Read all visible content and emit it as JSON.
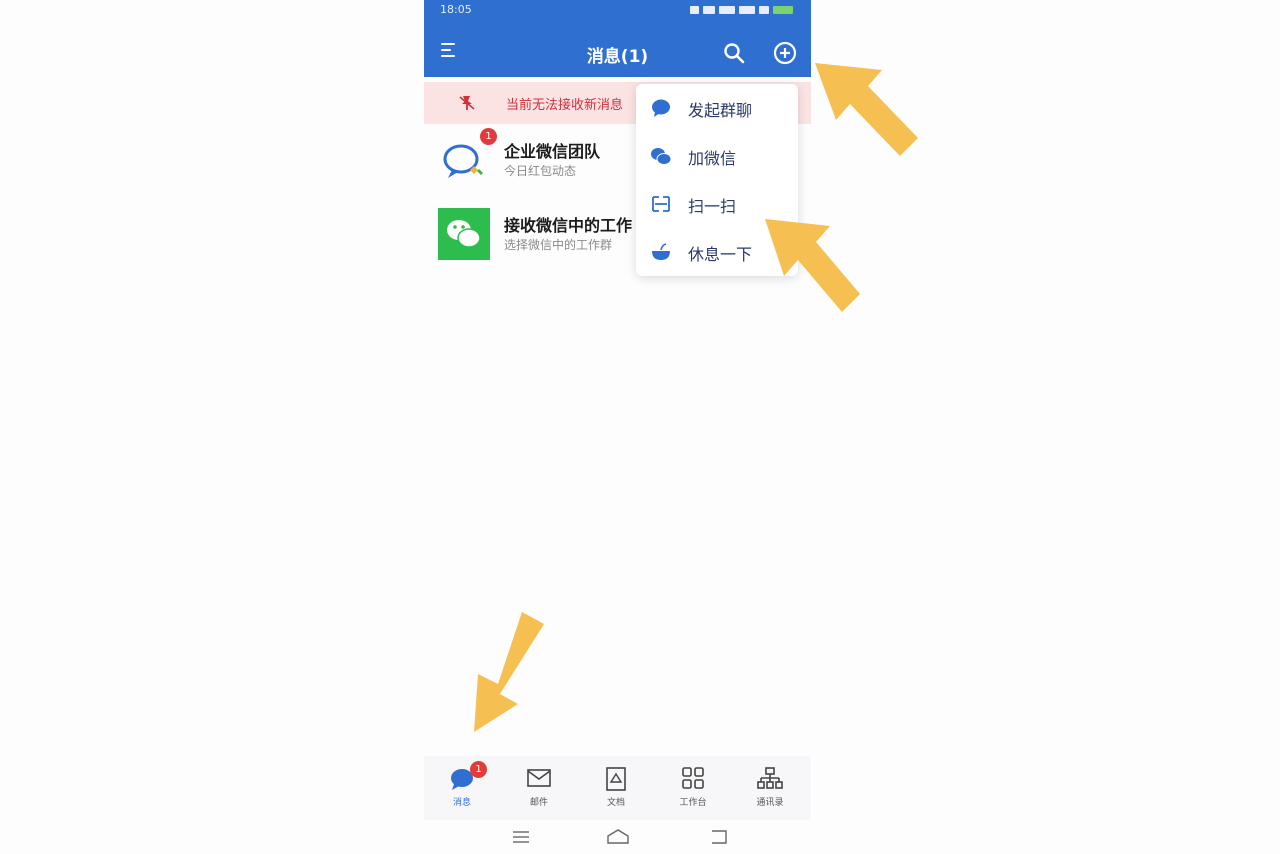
{
  "status_bar": {
    "time": "18:05"
  },
  "header": {
    "title": "消息(1)",
    "menu_icon": "menu-icon",
    "search_icon": "search-icon",
    "add_icon": "plus-circle-icon",
    "color": "#2f6fcf"
  },
  "banner": {
    "text": "当前无法接收新消息",
    "icon": "notification-off-icon"
  },
  "chats": [
    {
      "name": "企业微信团队",
      "preview": "今日红包动态",
      "badge": "1",
      "avatar": "wecom-logo"
    },
    {
      "name": "接收微信中的工作",
      "preview": "选择微信中的工作群",
      "avatar": "wechat-logo"
    }
  ],
  "popup_menu": {
    "items": [
      {
        "label": "发起群聊",
        "icon": "chat-bubble-icon"
      },
      {
        "label": "加微信",
        "icon": "wechat-icon"
      },
      {
        "label": "扫一扫",
        "icon": "scan-icon"
      },
      {
        "label": "休息一下",
        "icon": "coffee-icon"
      }
    ]
  },
  "tab_bar": {
    "items": [
      {
        "label": "消息",
        "icon": "message-icon",
        "badge": "1",
        "active": true
      },
      {
        "label": "邮件",
        "icon": "mail-icon"
      },
      {
        "label": "文档",
        "icon": "document-icon"
      },
      {
        "label": "工作台",
        "icon": "workbench-icon"
      },
      {
        "label": "通讯录",
        "icon": "contacts-icon"
      }
    ]
  },
  "colors": {
    "accent": "#2f6fcf",
    "badge": "#e33b3b",
    "annotation_arrow": "#f4b93e",
    "banner_bg": "#fbe3e3"
  }
}
